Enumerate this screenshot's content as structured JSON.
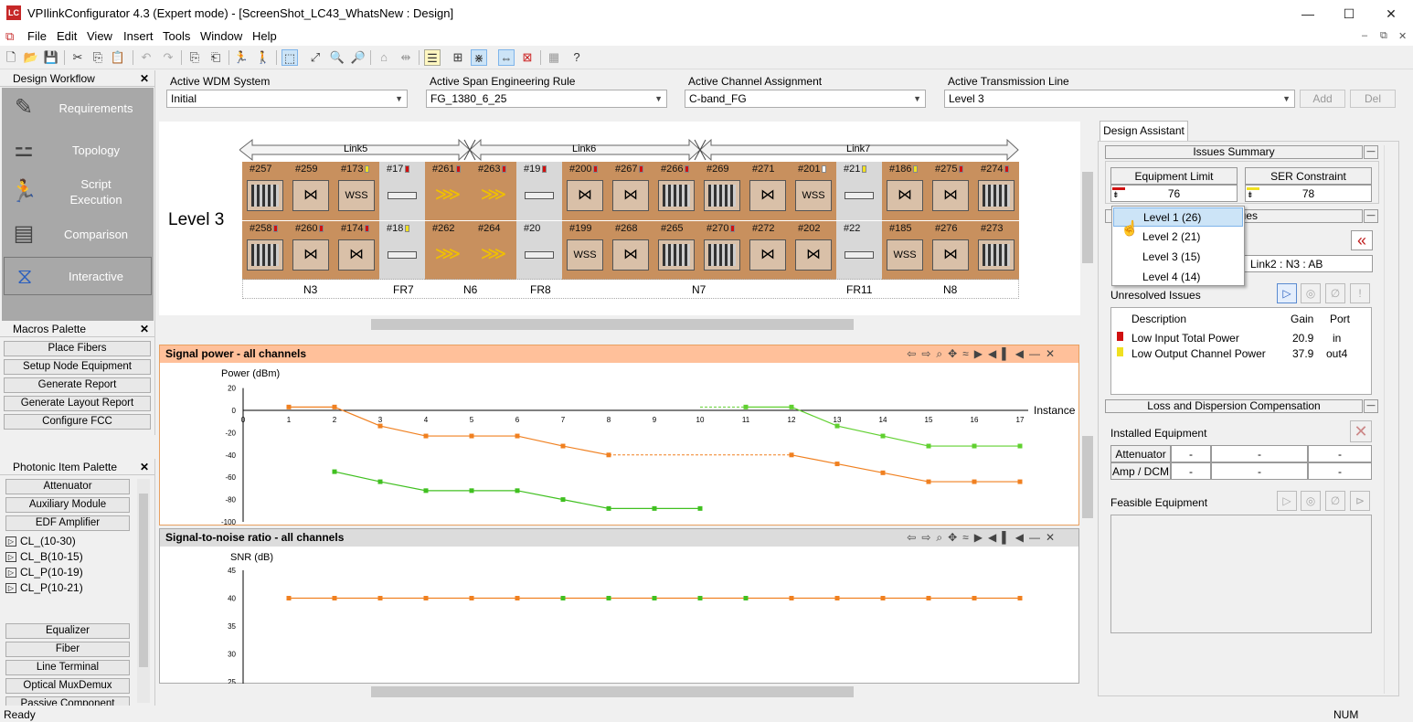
{
  "window": {
    "title": "VPIlinkConfigurator 4.3 (Expert mode) - [ScreenShot_LC43_WhatsNew : Design]",
    "icon_text": "LC"
  },
  "menu": [
    "File",
    "Edit",
    "View",
    "Insert",
    "Tools",
    "Window",
    "Help"
  ],
  "workflow": {
    "title": "Design Workflow",
    "items": [
      {
        "label": "Requirements",
        "icon": "requirements-icon"
      },
      {
        "label": "Topology",
        "icon": "topology-icon"
      },
      {
        "label": "Script\nExecution",
        "icon": "script-execution-icon"
      },
      {
        "label": "Comparison",
        "icon": "comparison-icon"
      },
      {
        "label": "Interactive",
        "icon": "interactive-icon"
      }
    ]
  },
  "macros": {
    "title": "Macros Palette",
    "items": [
      "Place Fibers",
      "Setup Node Equipment",
      "Generate Report",
      "Generate Layout Report",
      "Configure FCC"
    ]
  },
  "photonic": {
    "title": "Photonic Item Palette",
    "items": [
      "Attenuator",
      "Auxiliary Module",
      "EDF Amplifier"
    ],
    "amps": [
      "CL_(10-30)",
      "CL_B(10-15)",
      "CL_P(10-19)",
      "CL_P(10-21)"
    ],
    "items2": [
      "Equalizer",
      "Fiber",
      "Line Terminal",
      "Optical MuxDemux",
      "Passive Component"
    ]
  },
  "selectors": {
    "wdm": {
      "label": "Active WDM System",
      "value": "Initial"
    },
    "span": {
      "label": "Active Span Engineering Rule",
      "value": "FG_1380_6_25"
    },
    "channel": {
      "label": "Active Channel Assignment",
      "value": "C-band_FG"
    },
    "line": {
      "label": "Active Transmission Line",
      "value": "Level 3"
    },
    "add": "Add",
    "del": "Del"
  },
  "design": {
    "level_label": "Level 3",
    "links": [
      "Link5",
      "Link6",
      "Link7"
    ],
    "top_tags": [
      "#257",
      "#259",
      "#173",
      "#17",
      "#261",
      "#263",
      "#19",
      "#200",
      "#267",
      "#266",
      "#269",
      "#271",
      "#201",
      "#21",
      "#186",
      "#275",
      "#274"
    ],
    "bottom_tags": [
      "#258",
      "#260",
      "#174",
      "#18",
      "#262",
      "#264",
      "#20",
      "#199",
      "#268",
      "#265",
      "#270",
      "#272",
      "#202",
      "#22",
      "#185",
      "#276",
      "#273"
    ],
    "top_marks": [
      "",
      "",
      "y",
      "r",
      "r",
      "r",
      "r",
      "r",
      "r",
      "r",
      "",
      "",
      "w",
      "y",
      "y",
      "r",
      "r"
    ],
    "bottom_marks": [
      "r",
      "r",
      "r",
      "y",
      "",
      "",
      "",
      "",
      "",
      "",
      "r",
      "",
      "",
      "",
      "",
      "",
      ""
    ],
    "node_labels": [
      "N3",
      "FR7",
      "N6",
      "FR8",
      "N7",
      "FR11",
      "N8"
    ],
    "wss": "WSS"
  },
  "chart1": {
    "title": "Signal power - all channels",
    "ylabel": "Power (dBm)",
    "xlabel": "Instance"
  },
  "chart2": {
    "title": "Signal-to-noise ratio - all channels",
    "ylabel": "SNR (dB)"
  },
  "chart_data": [
    {
      "type": "line",
      "title": "Signal power - all channels",
      "xlabel": "Instance",
      "ylabel": "Power (dBm)",
      "ylim": [
        -100,
        20
      ],
      "xlim": [
        0,
        17
      ],
      "x_ticks": [
        0,
        1,
        2,
        3,
        4,
        5,
        6,
        7,
        8,
        9,
        10,
        11,
        12,
        13,
        14,
        15,
        16,
        17
      ],
      "y_ticks": [
        20,
        0,
        -20,
        -40,
        -60,
        -80,
        -100
      ],
      "series": [
        {
          "color": "#f08020",
          "x": [
            1,
            2,
            3,
            4,
            5,
            6,
            7,
            8
          ],
          "values": [
            3,
            3,
            -14,
            -23,
            -23,
            -23,
            -32,
            -40
          ]
        },
        {
          "color": "#f08020",
          "x": [
            12,
            13,
            14,
            15,
            16,
            17
          ],
          "values": [
            -40,
            -48,
            -56,
            -64,
            -64,
            -64
          ]
        },
        {
          "color": "#40c020",
          "x": [
            2,
            3,
            4,
            5,
            6,
            7,
            8,
            9,
            10
          ],
          "values": [
            -55,
            -64,
            -72,
            -72,
            -72,
            -80,
            -88,
            -88,
            -88
          ]
        },
        {
          "color": "#60d030",
          "x": [
            11,
            12,
            13,
            14,
            15,
            16,
            17
          ],
          "values": [
            3,
            3,
            -14,
            -23,
            -32,
            -32,
            -32
          ]
        }
      ]
    },
    {
      "type": "line",
      "title": "Signal-to-noise ratio - all channels",
      "ylabel": "SNR (dB)",
      "ylim": [
        25,
        45
      ],
      "y_ticks": [
        45,
        40,
        35,
        30,
        25
      ],
      "series": [
        {
          "color": "#f08020",
          "x": [
            1,
            2,
            3,
            4,
            5,
            6,
            7,
            8,
            9,
            10,
            11,
            12,
            13,
            14,
            15,
            16,
            17
          ],
          "values": [
            40,
            40,
            40,
            40,
            40,
            40,
            40,
            40,
            40,
            40,
            40,
            40,
            40,
            40,
            40,
            40,
            40
          ]
        }
      ]
    }
  ],
  "assistant": {
    "tab": "Design Assistant",
    "issues_summary": "Issues Summary",
    "elv": {
      "label": "Equipment Limit Violations",
      "value": "76"
    },
    "scv": {
      "label": "SER Constraint Violations",
      "value": "78"
    },
    "issues_suffix": "ssues",
    "path": "Link2 : N3 : AB",
    "unresolved": "Unresolved Issues",
    "cols": [
      "Description",
      "Gain",
      "Port"
    ],
    "rows": [
      {
        "color": "#d01010",
        "desc": "Low Input Total Power",
        "gain": "20.9",
        "port": "in"
      },
      {
        "color": "#f0e020",
        "desc": "Low Output Channel Power",
        "gain": "37.9",
        "port": "out4"
      }
    ],
    "loss": "Loss and Dispersion Compensation",
    "installed": "Installed Equipment",
    "inst_rows": [
      {
        "name": "Attenuator",
        "a": "-",
        "b": "-",
        "c": "-"
      },
      {
        "name": "Amp / DCM",
        "a": "-",
        "b": "-",
        "c": "-"
      }
    ],
    "feasible": "Feasible Equipment"
  },
  "dropdown": [
    "Level 1 (26)",
    "Level 2 (21)",
    "Level 3 (15)",
    "Level 4 (14)"
  ],
  "status": {
    "left": "Ready",
    "right": "NUM"
  }
}
